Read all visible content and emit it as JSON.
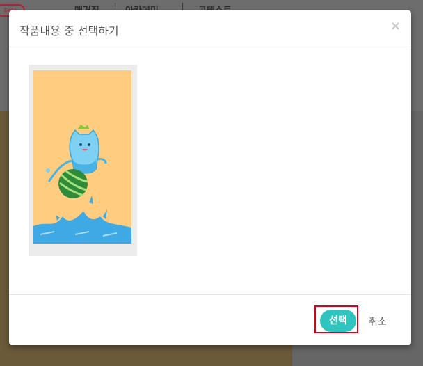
{
  "background": {
    "badge": "Beta",
    "nav_items": [
      "매거진",
      "아카데미",
      "콘테스트"
    ]
  },
  "modal": {
    "title": "작품내용 중 선택하기",
    "close_label": "×",
    "select_label": "선택",
    "cancel_label": "취소"
  },
  "colors": {
    "accent": "#2ec4c0",
    "highlight_border": "#d6001c",
    "thumb_background": "#ffcc80",
    "water": "#3fa9e6"
  },
  "icons": {
    "close": "close-icon"
  }
}
